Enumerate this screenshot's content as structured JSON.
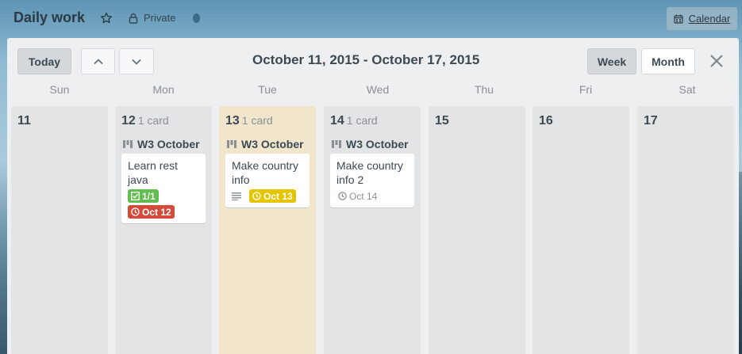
{
  "board": {
    "title": "Daily work",
    "privacy": "Private"
  },
  "calendar_button": {
    "label": "Calendar"
  },
  "toolbar": {
    "today_label": "Today",
    "range_title": "October 11, 2015 - October 17, 2015",
    "week_label": "Week",
    "month_label": "Month"
  },
  "day_names": [
    "Sun",
    "Mon",
    "Tue",
    "Wed",
    "Thu",
    "Fri",
    "Sat"
  ],
  "days": [
    {
      "number": "11",
      "count": ""
    },
    {
      "number": "12",
      "count": "1 card",
      "list": "W3 October",
      "card": {
        "title": "Learn rest java",
        "checklist": "1/1",
        "due": "Oct 12",
        "due_status": "overdue"
      }
    },
    {
      "number": "13",
      "count": "1 card",
      "list": "W3 October",
      "card": {
        "title": "Make country info",
        "due": "Oct 13",
        "due_status": "due-soon",
        "has_description": true
      }
    },
    {
      "number": "14",
      "count": "1 card",
      "list": "W3 October",
      "card": {
        "title": "Make country info 2",
        "due": "Oct 14",
        "due_status": "upcoming"
      }
    },
    {
      "number": "15",
      "count": ""
    },
    {
      "number": "16",
      "count": ""
    },
    {
      "number": "17",
      "count": ""
    }
  ],
  "colors": {
    "today_column": "#f1e5cc",
    "badge_checklist_complete": "#61bd4f",
    "badge_overdue": "#d44a3a",
    "badge_due_soon": "#e5c500"
  },
  "icons": {
    "star": "star-icon",
    "lock": "lock-icon",
    "calendar": "calendar-icon",
    "prev": "chevron-up-icon",
    "next": "chevron-down-icon",
    "close": "close-icon",
    "list": "list-icon",
    "checklist": "checklist-icon",
    "clock": "clock-icon",
    "description": "description-icon"
  }
}
